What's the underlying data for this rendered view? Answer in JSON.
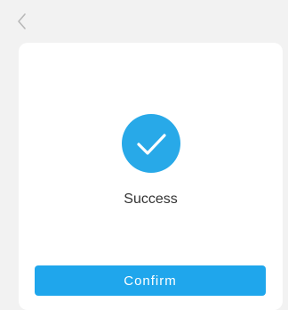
{
  "header": {
    "back_icon": "chevron-left-icon"
  },
  "result": {
    "icon": "checkmark-icon",
    "status_text": "Success",
    "accent_color": "#28a9e8"
  },
  "actions": {
    "confirm_label": "Confirm",
    "confirm_color": "#1fa6ec"
  }
}
